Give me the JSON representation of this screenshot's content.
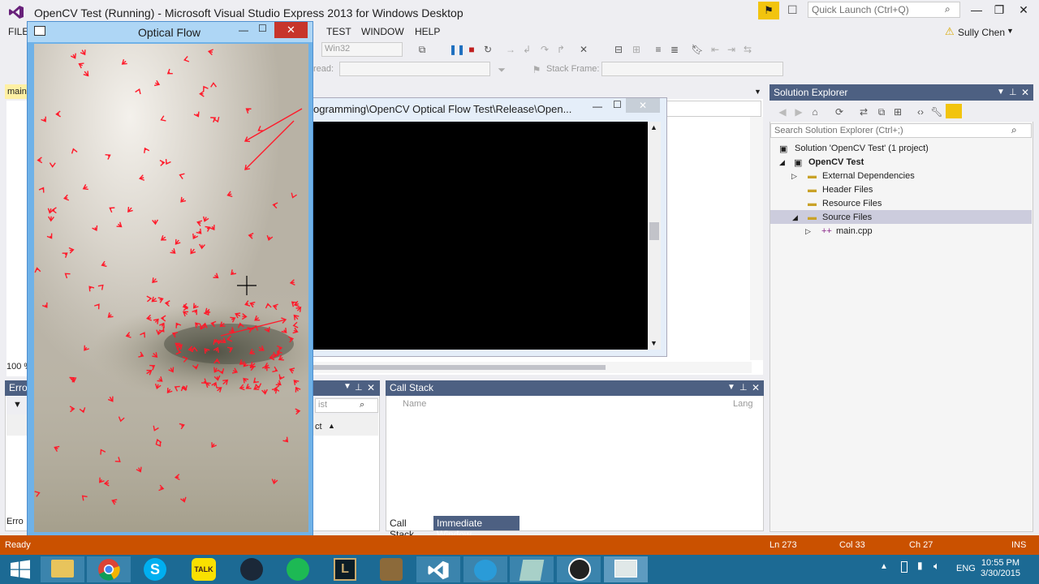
{
  "window": {
    "title": "OpenCV Test (Running) - Microsoft Visual Studio Express 2013 for Windows Desktop",
    "quick_launch_placeholder": "Quick Launch (Ctrl+Q)"
  },
  "menu": {
    "items": [
      "FILE",
      "TEST",
      "WINDOW",
      "HELP"
    ],
    "user": "Sully Chen"
  },
  "toolbar": {
    "platform": "Win32",
    "thread_label": "read:",
    "stack_frame_label": "Stack Frame:"
  },
  "optical_flow": {
    "title": "Optical Flow"
  },
  "console": {
    "title": "ogramming\\OpenCV Optical Flow Test\\Release\\Open..."
  },
  "left_partial": {
    "tab": "main",
    "zoom": "100 %",
    "error_head": "Erro",
    "error_footer": "Erro"
  },
  "mid_panel": {
    "search_partial": "ist",
    "column_partial": "ct"
  },
  "solution_explorer": {
    "title": "Solution Explorer",
    "search_placeholder": "Search Solution Explorer (Ctrl+;)",
    "solution": "Solution 'OpenCV Test' (1 project)",
    "project": "OpenCV Test",
    "items": [
      "External Dependencies",
      "Header Files",
      "Resource Files",
      "Source Files",
      "main.cpp"
    ]
  },
  "call_stack": {
    "title": "Call Stack",
    "col_name": "Name",
    "col_lang": "Lang",
    "tabs": [
      "Call Stack",
      "Immediate Window"
    ]
  },
  "status_bar": {
    "state": "Ready",
    "line": "Ln 273",
    "col": "Col 33",
    "ch": "Ch 27",
    "mode": "INS"
  },
  "taskbar": {
    "lang": "ENG",
    "time": "10:55 PM",
    "date": "3/30/2015"
  }
}
